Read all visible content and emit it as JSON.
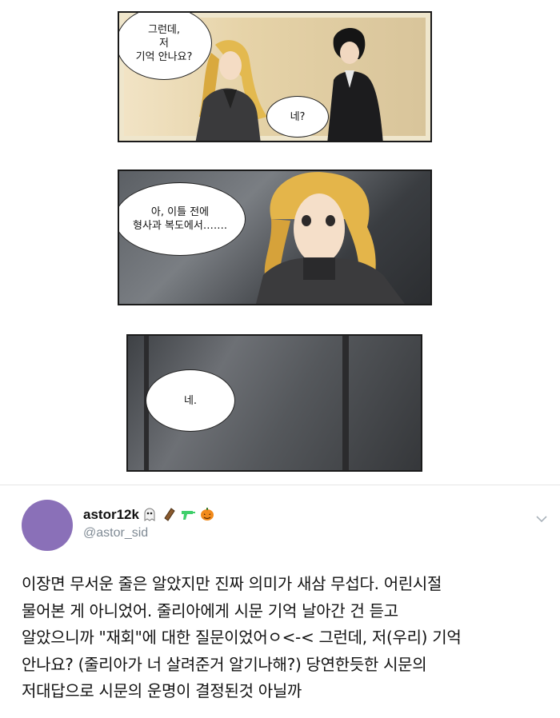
{
  "comic": {
    "panel1": {
      "bubble_left": "그런데,\n저\n기억 안나요?",
      "bubble_right": "네?"
    },
    "panel2": {
      "bubble": "아, 이틀 전에\n형사과 복도에서……."
    },
    "panel3": {
      "bubble": "네."
    }
  },
  "tweet": {
    "display_name": "astor12k",
    "handle": "@astor_sid",
    "emoji_icons": [
      "ghost-icon",
      "coffin-icon",
      "water-gun-icon",
      "jack-o-lantern-icon"
    ],
    "avatar_color": "#8a70b8",
    "text": "이장면 무서운 줄은 알았지만 진짜 의미가 새삼 무섭다. 어린시절\n물어본 게 아니었어. 줄리아에게 시문 기억 날아간 건 듣고\n알았으니까 \"재회\"에 대한 질문이었어ㅇ<-< 그런데, 저(우리) 기억\n안나요? (줄리아가 너 살려준거 알기나해?) 당연한듯한 시문의\n저대답으로 시문의 운명이 결정된것 아닐까"
  }
}
